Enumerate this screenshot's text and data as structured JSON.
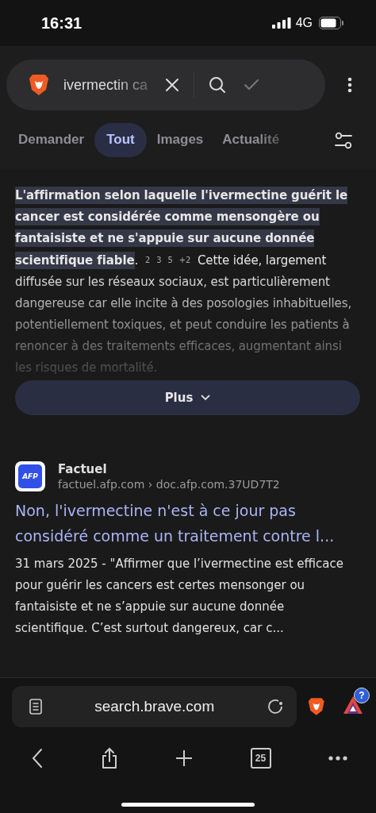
{
  "status_bar": {
    "time": "16:31",
    "network": "4G"
  },
  "search": {
    "query": "ivermectin ca"
  },
  "tabs": [
    {
      "label": "Demander",
      "selected": false
    },
    {
      "label": "Tout",
      "selected": true
    },
    {
      "label": "Images",
      "selected": false
    },
    {
      "label": "Actualité",
      "selected": false
    }
  ],
  "answer": {
    "highlight": "L'affirmation selon laquelle l'ivermectine guérit le cancer est considérée comme mensongère ou fantaisiste et ne s'appuie sur aucune donnée scientifique fiable",
    "after_highlight": ".",
    "citations": [
      "2",
      "3",
      "5",
      "+2"
    ],
    "text": "Cette idée, largement diffusée sur les réseaux sociaux, est particulièrement dangereuse car elle incite à des posologies inhabituelles, potentiellement toxiques, et peut conduire les patients à renoncer à des traitements efficaces, augmentant ainsi les risques de mortalité.",
    "more_button": "Plus"
  },
  "results": [
    {
      "logo": "AFP",
      "source": "Factuel",
      "url": "factuel.afp.com › doc.afp.com.37UD7T2",
      "title": "Non, l'ivermectine n'est à ce jour pas considéré comme un traitement contre l...",
      "snippet": "31 mars 2025 - \"Affirmer que l’ivermectine est efficace pour guérir les cancers est certes mensonger ou fantaisiste et ne s’appuie sur aucune donnée scientifique. C’est surtout dangereux, car c..."
    }
  ],
  "address_bar": {
    "url": "search.brave.com"
  },
  "rewards_badge": "?",
  "toolbar": {
    "tab_count": "25"
  }
}
